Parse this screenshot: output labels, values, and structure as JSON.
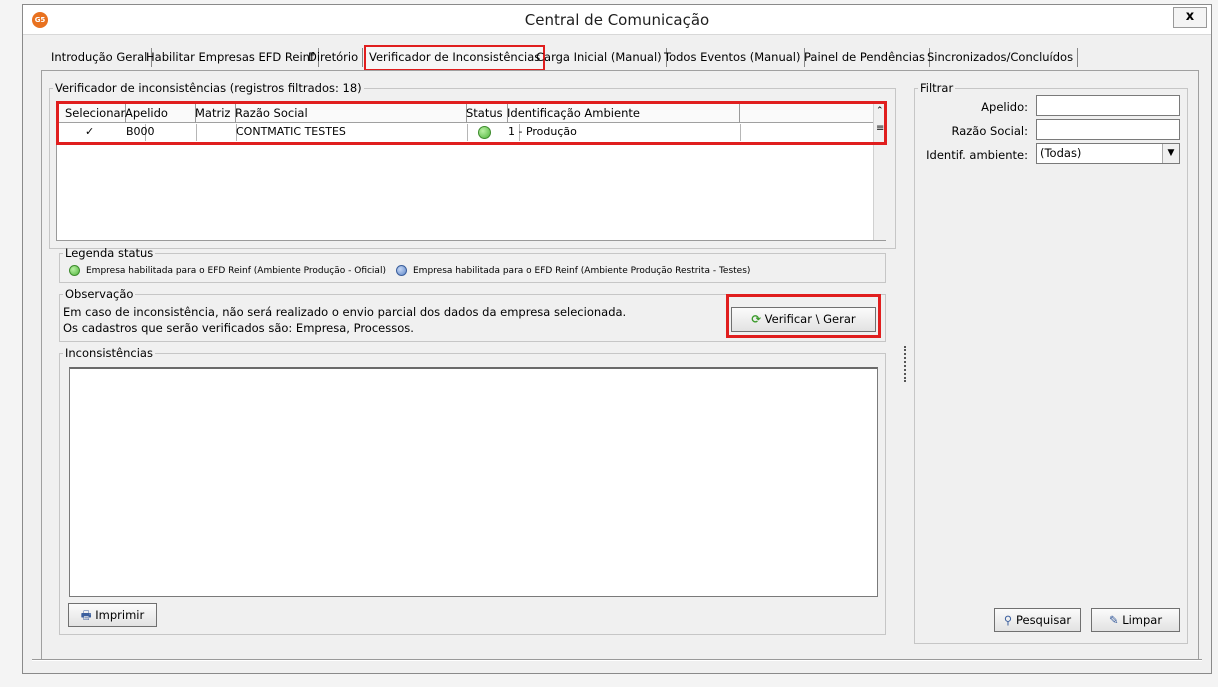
{
  "window": {
    "title": "Central de Comunicação",
    "close_label": "x",
    "app_icon_text": "G5"
  },
  "tabs": [
    {
      "label": "Introdução Geral"
    },
    {
      "label": "Habilitar Empresas EFD Reinf"
    },
    {
      "label": "Diretório"
    },
    {
      "label": "Verificador de Inconsistências"
    },
    {
      "label": "Carga Inicial (Manual)"
    },
    {
      "label": "Todos Eventos (Manual)"
    },
    {
      "label": "Painel de Pendências"
    },
    {
      "label": "Sincronizados/Concluídos"
    }
  ],
  "verifier": {
    "legend": "Verificador de inconsistências (registros filtrados: 18)",
    "columns": [
      "Selecionar",
      "Apelido",
      "Matriz",
      "Razão Social",
      "Status",
      "Identificação Ambiente"
    ],
    "rows": [
      {
        "selected": "✓",
        "apelido": "B000",
        "matriz": "",
        "razao_social": "CONTMATIC  TESTES",
        "status": "green",
        "ambiente": "1 - Produção"
      }
    ]
  },
  "status_legend": {
    "title": "Legenda status",
    "green_label": "Empresa habilitada para o EFD Reinf (Ambiente Produção - Oficial)",
    "blue_label": "Empresa habilitada para o EFD Reinf (Ambiente Produção Restrita - Testes)"
  },
  "observation": {
    "title": "Observação",
    "line1": "Em caso de inconsistência, não será realizado o envio parcial dos dados da empresa selecionada.",
    "line2": "Os cadastros que serão verificados são: Empresa, Processos.",
    "verify_button": "Verificar \\ Gerar"
  },
  "inconsistencies": {
    "title": "Inconsistências",
    "text": ""
  },
  "print_button": "Imprimir",
  "filter": {
    "title": "Filtrar",
    "apelido_label": "Apelido:",
    "apelido_value": "",
    "razao_label": "Razão Social:",
    "razao_value": "",
    "ambiente_label": "Identif. ambiente:",
    "ambiente_value": "(Todas)",
    "search_button": "Pesquisar",
    "clear_button": "Limpar"
  },
  "colors": {
    "highlight": "#e01e1e",
    "status_green": "#4fb53b",
    "status_blue": "#5f87c8"
  }
}
